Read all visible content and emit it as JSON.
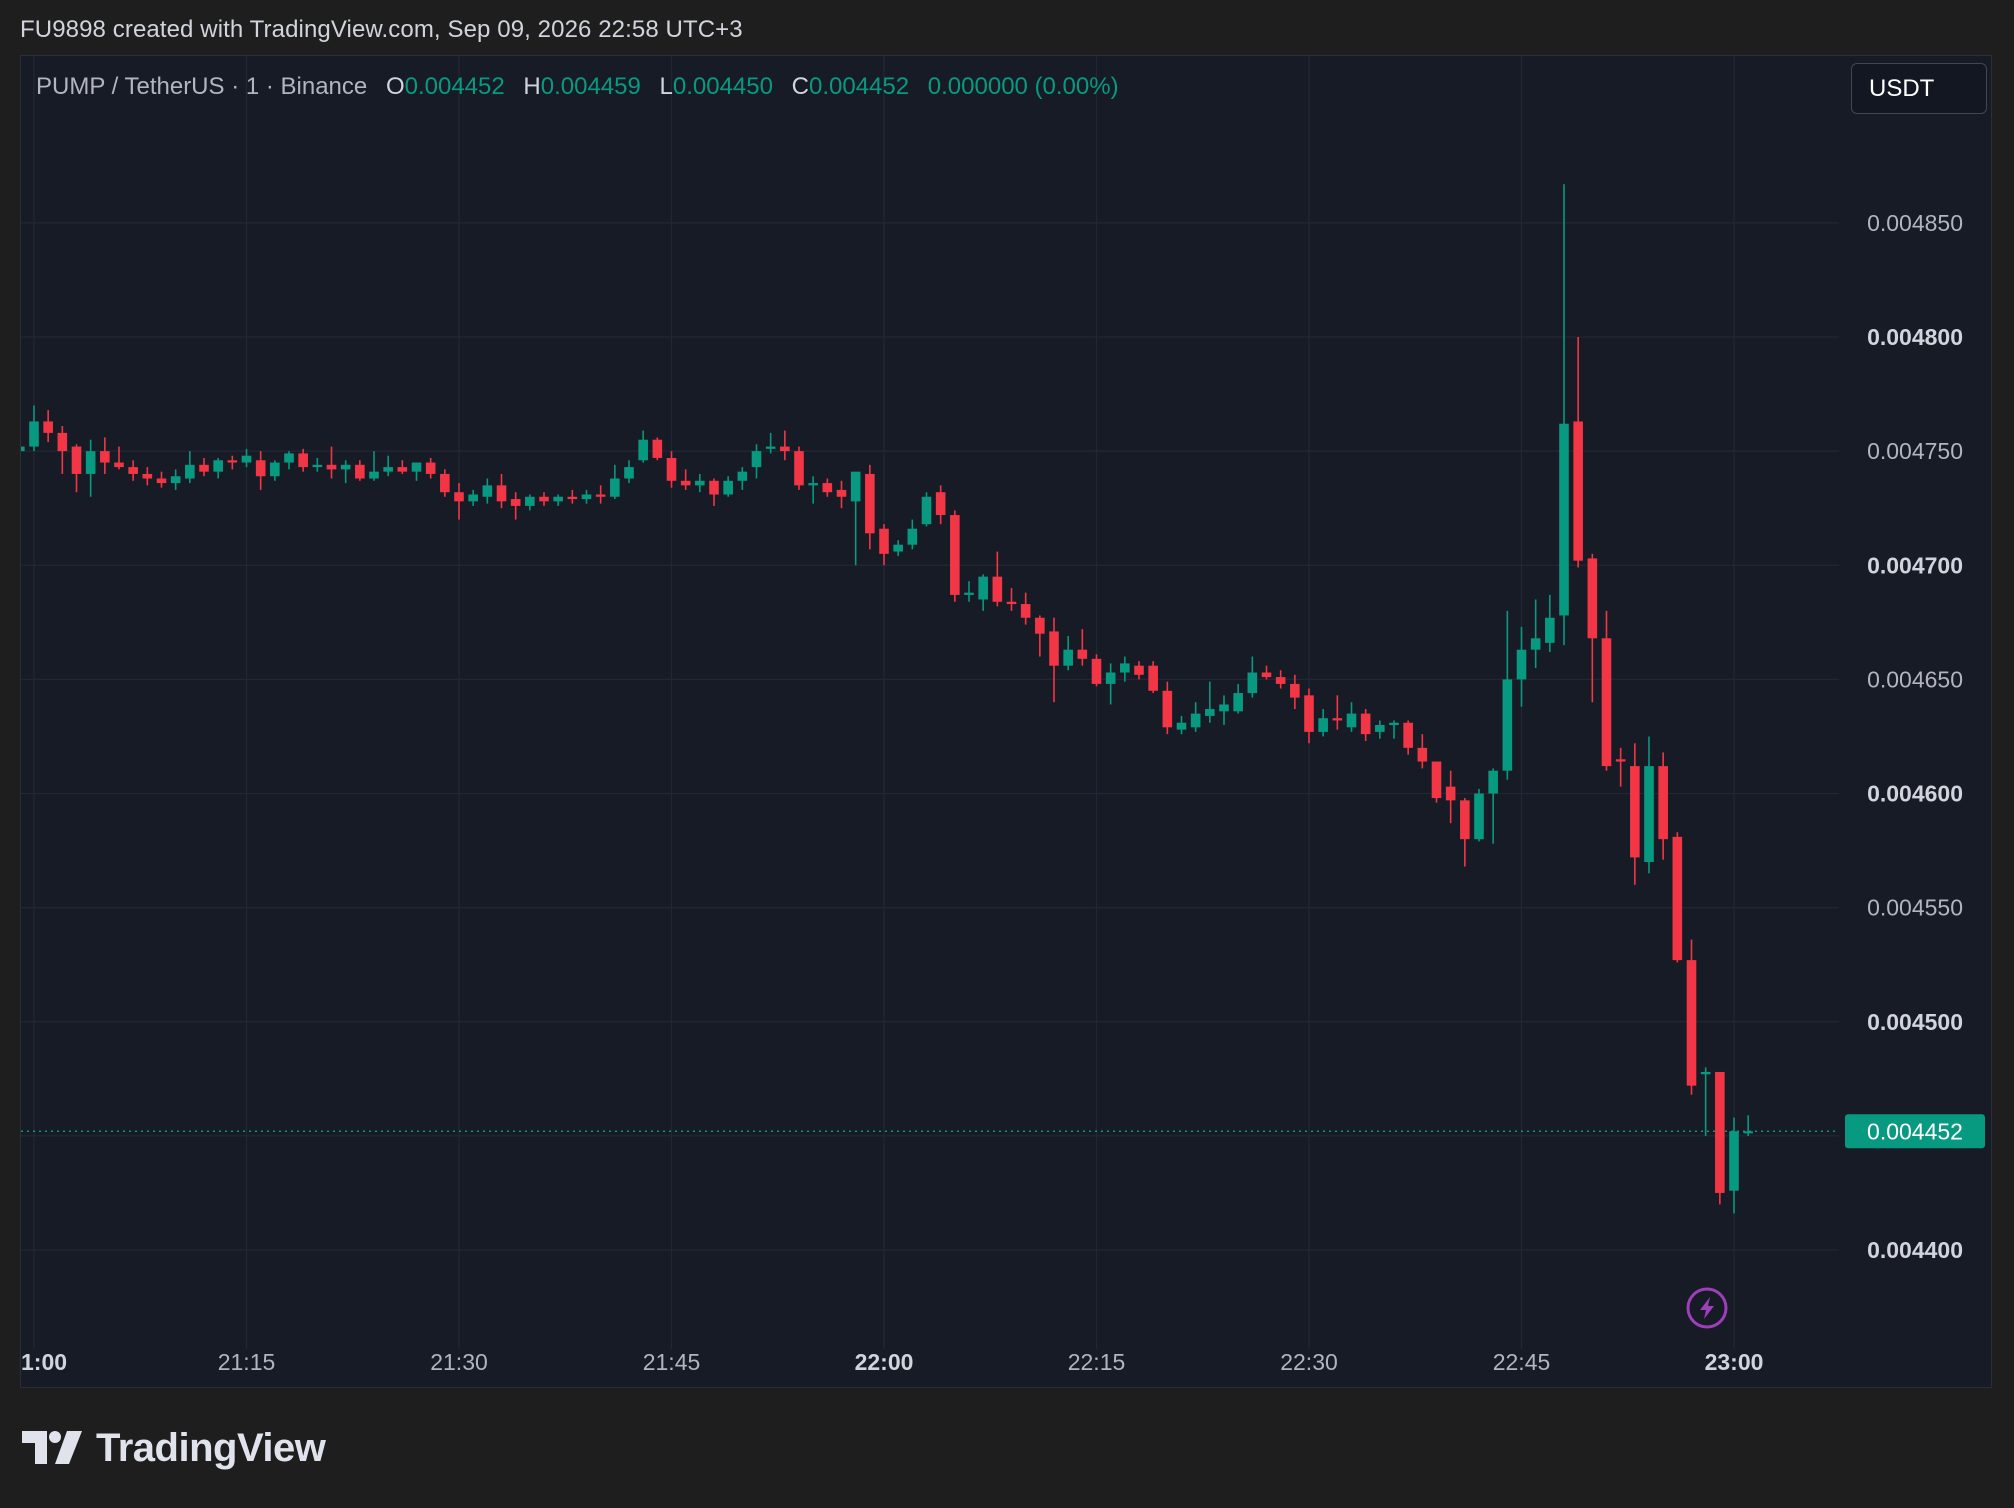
{
  "header": {
    "title": "FU9898 created with TradingView.com, Sep 09, 2026 22:58 UTC+3"
  },
  "legend": {
    "symbol": "PUMP / TetherUS · 1 · Binance",
    "open_label": "O",
    "open": "0.004452",
    "high_label": "H",
    "high": "0.004459",
    "low_label": "L",
    "low": "0.004450",
    "close_label": "C",
    "close": "0.004452",
    "change": "0.000000 (0.00%)"
  },
  "currency_button": "USDT",
  "last_price_label": "0.004452",
  "footer": {
    "brand": "TradingView",
    "logo_icon": "tradingview-logo-icon"
  },
  "colors": {
    "up": "#089981",
    "down": "#f23645",
    "background": "#171b26",
    "grid": "#232734",
    "last_price": "#089981",
    "lightning": "#9c3fb8"
  },
  "chart_data": {
    "type": "candlestick",
    "timeframe": "1m",
    "symbol": "PUMP/USDT",
    "exchange": "Binance",
    "ylim": [
      0.00437,
      0.00488
    ],
    "y_ticks": [
      {
        "value": 0.00485,
        "label": "0.004850",
        "bold": false
      },
      {
        "value": 0.0048,
        "label": "0.004800",
        "bold": true
      },
      {
        "value": 0.00475,
        "label": "0.004750",
        "bold": false
      },
      {
        "value": 0.0047,
        "label": "0.004700",
        "bold": true
      },
      {
        "value": 0.00465,
        "label": "0.004650",
        "bold": false
      },
      {
        "value": 0.0046,
        "label": "0.004600",
        "bold": true
      },
      {
        "value": 0.00455,
        "label": "0.004550",
        "bold": false
      },
      {
        "value": 0.0045,
        "label": "0.004500",
        "bold": true
      },
      {
        "value": 0.0044,
        "label": "0.004400",
        "bold": true
      }
    ],
    "x_ticks": [
      {
        "time": "21:00",
        "label": "1:00",
        "bold": true
      },
      {
        "time": "21:15",
        "label": "21:15",
        "bold": false
      },
      {
        "time": "21:30",
        "label": "21:30",
        "bold": false
      },
      {
        "time": "21:45",
        "label": "21:45",
        "bold": false
      },
      {
        "time": "22:00",
        "label": "22:00",
        "bold": true
      },
      {
        "time": "22:15",
        "label": "22:15",
        "bold": false
      },
      {
        "time": "22:30",
        "label": "22:30",
        "bold": false
      },
      {
        "time": "22:45",
        "label": "22:45",
        "bold": false
      },
      {
        "time": "23:00",
        "label": "23:00",
        "bold": true
      }
    ],
    "last_price": 0.004452,
    "candles": [
      {
        "t": "20:59",
        "o": 0.00475,
        "h": 0.00476,
        "l": 0.004748,
        "c": 0.004752
      },
      {
        "t": "21:00",
        "o": 0.004752,
        "h": 0.00477,
        "l": 0.00475,
        "c": 0.004763
      },
      {
        "t": "21:01",
        "o": 0.004763,
        "h": 0.004768,
        "l": 0.004754,
        "c": 0.004758
      },
      {
        "t": "21:02",
        "o": 0.004758,
        "h": 0.004761,
        "l": 0.00474,
        "c": 0.00475
      },
      {
        "t": "21:03",
        "o": 0.004752,
        "h": 0.004753,
        "l": 0.004732,
        "c": 0.00474
      },
      {
        "t": "21:04",
        "o": 0.00474,
        "h": 0.004755,
        "l": 0.00473,
        "c": 0.00475
      },
      {
        "t": "21:05",
        "o": 0.00475,
        "h": 0.004756,
        "l": 0.00474,
        "c": 0.004745
      },
      {
        "t": "21:06",
        "o": 0.004745,
        "h": 0.004752,
        "l": 0.004742,
        "c": 0.004743
      },
      {
        "t": "21:07",
        "o": 0.004743,
        "h": 0.004746,
        "l": 0.004737,
        "c": 0.00474
      },
      {
        "t": "21:08",
        "o": 0.00474,
        "h": 0.004743,
        "l": 0.004735,
        "c": 0.004738
      },
      {
        "t": "21:09",
        "o": 0.004738,
        "h": 0.004741,
        "l": 0.004734,
        "c": 0.004736
      },
      {
        "t": "21:10",
        "o": 0.004736,
        "h": 0.004742,
        "l": 0.004733,
        "c": 0.004739
      },
      {
        "t": "21:11",
        "o": 0.004738,
        "h": 0.00475,
        "l": 0.004736,
        "c": 0.004744
      },
      {
        "t": "21:12",
        "o": 0.004744,
        "h": 0.004747,
        "l": 0.004739,
        "c": 0.004741
      },
      {
        "t": "21:13",
        "o": 0.004741,
        "h": 0.004747,
        "l": 0.004738,
        "c": 0.004746
      },
      {
        "t": "21:14",
        "o": 0.004746,
        "h": 0.004748,
        "l": 0.004742,
        "c": 0.004745
      },
      {
        "t": "21:15",
        "o": 0.004745,
        "h": 0.004751,
        "l": 0.004743,
        "c": 0.004748
      },
      {
        "t": "21:16",
        "o": 0.004746,
        "h": 0.00475,
        "l": 0.004733,
        "c": 0.004739
      },
      {
        "t": "21:17",
        "o": 0.004739,
        "h": 0.004746,
        "l": 0.004737,
        "c": 0.004745
      },
      {
        "t": "21:18",
        "o": 0.004745,
        "h": 0.00475,
        "l": 0.004742,
        "c": 0.004749
      },
      {
        "t": "21:19",
        "o": 0.004749,
        "h": 0.004751,
        "l": 0.004741,
        "c": 0.004743
      },
      {
        "t": "21:20",
        "o": 0.004743,
        "h": 0.004747,
        "l": 0.004741,
        "c": 0.004744
      },
      {
        "t": "21:21",
        "o": 0.004744,
        "h": 0.004752,
        "l": 0.004738,
        "c": 0.004742
      },
      {
        "t": "21:22",
        "o": 0.004742,
        "h": 0.004746,
        "l": 0.004736,
        "c": 0.004744
      },
      {
        "t": "21:23",
        "o": 0.004744,
        "h": 0.004746,
        "l": 0.004737,
        "c": 0.004738
      },
      {
        "t": "21:24",
        "o": 0.004738,
        "h": 0.00475,
        "l": 0.004737,
        "c": 0.004741
      },
      {
        "t": "21:25",
        "o": 0.004741,
        "h": 0.004748,
        "l": 0.004739,
        "c": 0.004743
      },
      {
        "t": "21:26",
        "o": 0.004743,
        "h": 0.004746,
        "l": 0.00474,
        "c": 0.004741
      },
      {
        "t": "21:27",
        "o": 0.004741,
        "h": 0.004745,
        "l": 0.004737,
        "c": 0.004745
      },
      {
        "t": "21:28",
        "o": 0.004745,
        "h": 0.004747,
        "l": 0.004738,
        "c": 0.00474
      },
      {
        "t": "21:29",
        "o": 0.00474,
        "h": 0.004742,
        "l": 0.00473,
        "c": 0.004732
      },
      {
        "t": "21:30",
        "o": 0.004732,
        "h": 0.004736,
        "l": 0.00472,
        "c": 0.004728
      },
      {
        "t": "21:31",
        "o": 0.004728,
        "h": 0.004733,
        "l": 0.004726,
        "c": 0.004731
      },
      {
        "t": "21:32",
        "o": 0.00473,
        "h": 0.004738,
        "l": 0.004727,
        "c": 0.004735
      },
      {
        "t": "21:33",
        "o": 0.004735,
        "h": 0.00474,
        "l": 0.004725,
        "c": 0.004728
      },
      {
        "t": "21:34",
        "o": 0.004729,
        "h": 0.004732,
        "l": 0.00472,
        "c": 0.004726
      },
      {
        "t": "21:35",
        "o": 0.004726,
        "h": 0.004731,
        "l": 0.004724,
        "c": 0.00473
      },
      {
        "t": "21:36",
        "o": 0.00473,
        "h": 0.004732,
        "l": 0.004726,
        "c": 0.004728
      },
      {
        "t": "21:37",
        "o": 0.004728,
        "h": 0.004731,
        "l": 0.004726,
        "c": 0.00473
      },
      {
        "t": "21:38",
        "o": 0.00473,
        "h": 0.004733,
        "l": 0.004727,
        "c": 0.004729
      },
      {
        "t": "21:39",
        "o": 0.004729,
        "h": 0.004733,
        "l": 0.004727,
        "c": 0.004731
      },
      {
        "t": "21:40",
        "o": 0.004731,
        "h": 0.004735,
        "l": 0.004727,
        "c": 0.00473
      },
      {
        "t": "21:41",
        "o": 0.00473,
        "h": 0.004744,
        "l": 0.004729,
        "c": 0.004738
      },
      {
        "t": "21:42",
        "o": 0.004738,
        "h": 0.004746,
        "l": 0.004736,
        "c": 0.004743
      },
      {
        "t": "21:43",
        "o": 0.004746,
        "h": 0.004759,
        "l": 0.004745,
        "c": 0.004755
      },
      {
        "t": "21:44",
        "o": 0.004755,
        "h": 0.004756,
        "l": 0.004746,
        "c": 0.004747
      },
      {
        "t": "21:45",
        "o": 0.004747,
        "h": 0.00475,
        "l": 0.004734,
        "c": 0.004737
      },
      {
        "t": "21:46",
        "o": 0.004737,
        "h": 0.004742,
        "l": 0.004733,
        "c": 0.004735
      },
      {
        "t": "21:47",
        "o": 0.004735,
        "h": 0.00474,
        "l": 0.004732,
        "c": 0.004737
      },
      {
        "t": "21:48",
        "o": 0.004737,
        "h": 0.004738,
        "l": 0.004726,
        "c": 0.004731
      },
      {
        "t": "21:49",
        "o": 0.004731,
        "h": 0.004739,
        "l": 0.00473,
        "c": 0.004737
      },
      {
        "t": "21:50",
        "o": 0.004737,
        "h": 0.004743,
        "l": 0.004733,
        "c": 0.004741
      },
      {
        "t": "21:51",
        "o": 0.004743,
        "h": 0.004753,
        "l": 0.004738,
        "c": 0.00475
      },
      {
        "t": "21:52",
        "o": 0.004751,
        "h": 0.004758,
        "l": 0.004749,
        "c": 0.004752
      },
      {
        "t": "21:53",
        "o": 0.004752,
        "h": 0.004759,
        "l": 0.004746,
        "c": 0.00475
      },
      {
        "t": "21:54",
        "o": 0.00475,
        "h": 0.004752,
        "l": 0.004733,
        "c": 0.004735
      },
      {
        "t": "21:55",
        "o": 0.004735,
        "h": 0.004739,
        "l": 0.004727,
        "c": 0.004736
      },
      {
        "t": "21:56",
        "o": 0.004736,
        "h": 0.004738,
        "l": 0.00473,
        "c": 0.004732
      },
      {
        "t": "21:57",
        "o": 0.004733,
        "h": 0.004737,
        "l": 0.004725,
        "c": 0.00473
      },
      {
        "t": "21:58",
        "o": 0.004728,
        "h": 0.00474,
        "l": 0.0047,
        "c": 0.004741
      },
      {
        "t": "21:59",
        "o": 0.00474,
        "h": 0.004744,
        "l": 0.004707,
        "c": 0.004714
      },
      {
        "t": "22:00",
        "o": 0.004716,
        "h": 0.004718,
        "l": 0.0047,
        "c": 0.004705
      },
      {
        "t": "22:01",
        "o": 0.004706,
        "h": 0.004711,
        "l": 0.004704,
        "c": 0.004709
      },
      {
        "t": "22:02",
        "o": 0.004709,
        "h": 0.00472,
        "l": 0.004707,
        "c": 0.004716
      },
      {
        "t": "22:03",
        "o": 0.004718,
        "h": 0.004732,
        "l": 0.004717,
        "c": 0.00473
      },
      {
        "t": "22:04",
        "o": 0.004732,
        "h": 0.004735,
        "l": 0.004718,
        "c": 0.004722
      },
      {
        "t": "22:05",
        "o": 0.004722,
        "h": 0.004724,
        "l": 0.004684,
        "c": 0.004687
      },
      {
        "t": "22:06",
        "o": 0.004687,
        "h": 0.004693,
        "l": 0.004684,
        "c": 0.004688
      },
      {
        "t": "22:07",
        "o": 0.004685,
        "h": 0.004696,
        "l": 0.00468,
        "c": 0.004695
      },
      {
        "t": "22:08",
        "o": 0.004695,
        "h": 0.004706,
        "l": 0.004682,
        "c": 0.004684
      },
      {
        "t": "22:09",
        "o": 0.004684,
        "h": 0.00469,
        "l": 0.00468,
        "c": 0.004683
      },
      {
        "t": "22:10",
        "o": 0.004683,
        "h": 0.004688,
        "l": 0.004674,
        "c": 0.004677
      },
      {
        "t": "22:11",
        "o": 0.004677,
        "h": 0.004678,
        "l": 0.00466,
        "c": 0.00467
      },
      {
        "t": "22:12",
        "o": 0.004671,
        "h": 0.004677,
        "l": 0.00464,
        "c": 0.004656
      },
      {
        "t": "22:13",
        "o": 0.004656,
        "h": 0.004669,
        "l": 0.004654,
        "c": 0.004663
      },
      {
        "t": "22:14",
        "o": 0.004663,
        "h": 0.004672,
        "l": 0.004656,
        "c": 0.004659
      },
      {
        "t": "22:15",
        "o": 0.004659,
        "h": 0.004661,
        "l": 0.004647,
        "c": 0.004648
      },
      {
        "t": "22:16",
        "o": 0.004648,
        "h": 0.004657,
        "l": 0.004639,
        "c": 0.004653
      },
      {
        "t": "22:17",
        "o": 0.004653,
        "h": 0.00466,
        "l": 0.004649,
        "c": 0.004657
      },
      {
        "t": "22:18",
        "o": 0.004656,
        "h": 0.004658,
        "l": 0.00465,
        "c": 0.004652
      },
      {
        "t": "22:19",
        "o": 0.004656,
        "h": 0.004658,
        "l": 0.004644,
        "c": 0.004645
      },
      {
        "t": "22:20",
        "o": 0.004645,
        "h": 0.004649,
        "l": 0.004626,
        "c": 0.004629
      },
      {
        "t": "22:21",
        "o": 0.004628,
        "h": 0.004634,
        "l": 0.004626,
        "c": 0.004631
      },
      {
        "t": "22:22",
        "o": 0.004629,
        "h": 0.00464,
        "l": 0.004627,
        "c": 0.004635
      },
      {
        "t": "22:23",
        "o": 0.004634,
        "h": 0.004649,
        "l": 0.004631,
        "c": 0.004637
      },
      {
        "t": "22:24",
        "o": 0.004636,
        "h": 0.004643,
        "l": 0.00463,
        "c": 0.004639
      },
      {
        "t": "22:25",
        "o": 0.004636,
        "h": 0.004648,
        "l": 0.004635,
        "c": 0.004644
      },
      {
        "t": "22:26",
        "o": 0.004644,
        "h": 0.00466,
        "l": 0.004642,
        "c": 0.004653
      },
      {
        "t": "22:27",
        "o": 0.004653,
        "h": 0.004656,
        "l": 0.00465,
        "c": 0.004651
      },
      {
        "t": "22:28",
        "o": 0.004651,
        "h": 0.004654,
        "l": 0.004646,
        "c": 0.004648
      },
      {
        "t": "22:29",
        "o": 0.004648,
        "h": 0.004652,
        "l": 0.004637,
        "c": 0.004642
      },
      {
        "t": "22:30",
        "o": 0.004643,
        "h": 0.004646,
        "l": 0.004622,
        "c": 0.004627
      },
      {
        "t": "22:31",
        "o": 0.004627,
        "h": 0.004637,
        "l": 0.004625,
        "c": 0.004633
      },
      {
        "t": "22:32",
        "o": 0.004633,
        "h": 0.004643,
        "l": 0.004628,
        "c": 0.004632
      },
      {
        "t": "22:33",
        "o": 0.004629,
        "h": 0.00464,
        "l": 0.004627,
        "c": 0.004635
      },
      {
        "t": "22:34",
        "o": 0.004635,
        "h": 0.004637,
        "l": 0.004623,
        "c": 0.004626
      },
      {
        "t": "22:35",
        "o": 0.004627,
        "h": 0.004632,
        "l": 0.004624,
        "c": 0.00463
      },
      {
        "t": "22:36",
        "o": 0.00463,
        "h": 0.004632,
        "l": 0.004624,
        "c": 0.004631
      },
      {
        "t": "22:37",
        "o": 0.004631,
        "h": 0.004632,
        "l": 0.004617,
        "c": 0.00462
      },
      {
        "t": "22:38",
        "o": 0.00462,
        "h": 0.004626,
        "l": 0.004611,
        "c": 0.004614
      },
      {
        "t": "22:39",
        "o": 0.004614,
        "h": 0.004614,
        "l": 0.004596,
        "c": 0.004598
      },
      {
        "t": "22:40",
        "o": 0.004603,
        "h": 0.00461,
        "l": 0.004587,
        "c": 0.004597
      },
      {
        "t": "22:41",
        "o": 0.004597,
        "h": 0.004598,
        "l": 0.004568,
        "c": 0.00458
      },
      {
        "t": "22:42",
        "o": 0.00458,
        "h": 0.004602,
        "l": 0.004579,
        "c": 0.0046
      },
      {
        "t": "22:43",
        "o": 0.0046,
        "h": 0.004611,
        "l": 0.004578,
        "c": 0.00461
      },
      {
        "t": "22:44",
        "o": 0.00461,
        "h": 0.00468,
        "l": 0.004606,
        "c": 0.00465
      },
      {
        "t": "22:45",
        "o": 0.00465,
        "h": 0.004673,
        "l": 0.004638,
        "c": 0.004663
      },
      {
        "t": "22:46",
        "o": 0.004663,
        "h": 0.004685,
        "l": 0.004655,
        "c": 0.004668
      },
      {
        "t": "22:47",
        "o": 0.004666,
        "h": 0.004687,
        "l": 0.004662,
        "c": 0.004677
      },
      {
        "t": "22:48",
        "o": 0.004678,
        "h": 0.004867,
        "l": 0.004665,
        "c": 0.004762
      },
      {
        "t": "22:49",
        "o": 0.004763,
        "h": 0.0048,
        "l": 0.004699,
        "c": 0.004702
      },
      {
        "t": "22:50",
        "o": 0.004703,
        "h": 0.004705,
        "l": 0.00464,
        "c": 0.004668
      },
      {
        "t": "22:51",
        "o": 0.004668,
        "h": 0.00468,
        "l": 0.00461,
        "c": 0.004612
      },
      {
        "t": "22:52",
        "o": 0.004615,
        "h": 0.00462,
        "l": 0.004603,
        "c": 0.004614
      },
      {
        "t": "22:53",
        "o": 0.004612,
        "h": 0.004622,
        "l": 0.00456,
        "c": 0.004572
      },
      {
        "t": "22:54",
        "o": 0.00457,
        "h": 0.004625,
        "l": 0.004565,
        "c": 0.004612
      },
      {
        "t": "22:55",
        "o": 0.004612,
        "h": 0.004618,
        "l": 0.004571,
        "c": 0.00458
      },
      {
        "t": "22:56",
        "o": 0.004581,
        "h": 0.004583,
        "l": 0.004526,
        "c": 0.004527
      },
      {
        "t": "22:57",
        "o": 0.004527,
        "h": 0.004536,
        "l": 0.004468,
        "c": 0.004472
      },
      {
        "t": "22:58",
        "o": 0.004477,
        "h": 0.00448,
        "l": 0.00445,
        "c": 0.004478
      },
      {
        "t": "22:59",
        "o": 0.004478,
        "h": 0.004478,
        "l": 0.00442,
        "c": 0.004425
      },
      {
        "t": "23:00",
        "o": 0.004426,
        "h": 0.004458,
        "l": 0.004416,
        "c": 0.004452
      },
      {
        "t": "23:01",
        "o": 0.004452,
        "h": 0.004459,
        "l": 0.00445,
        "c": 0.004452
      }
    ]
  }
}
